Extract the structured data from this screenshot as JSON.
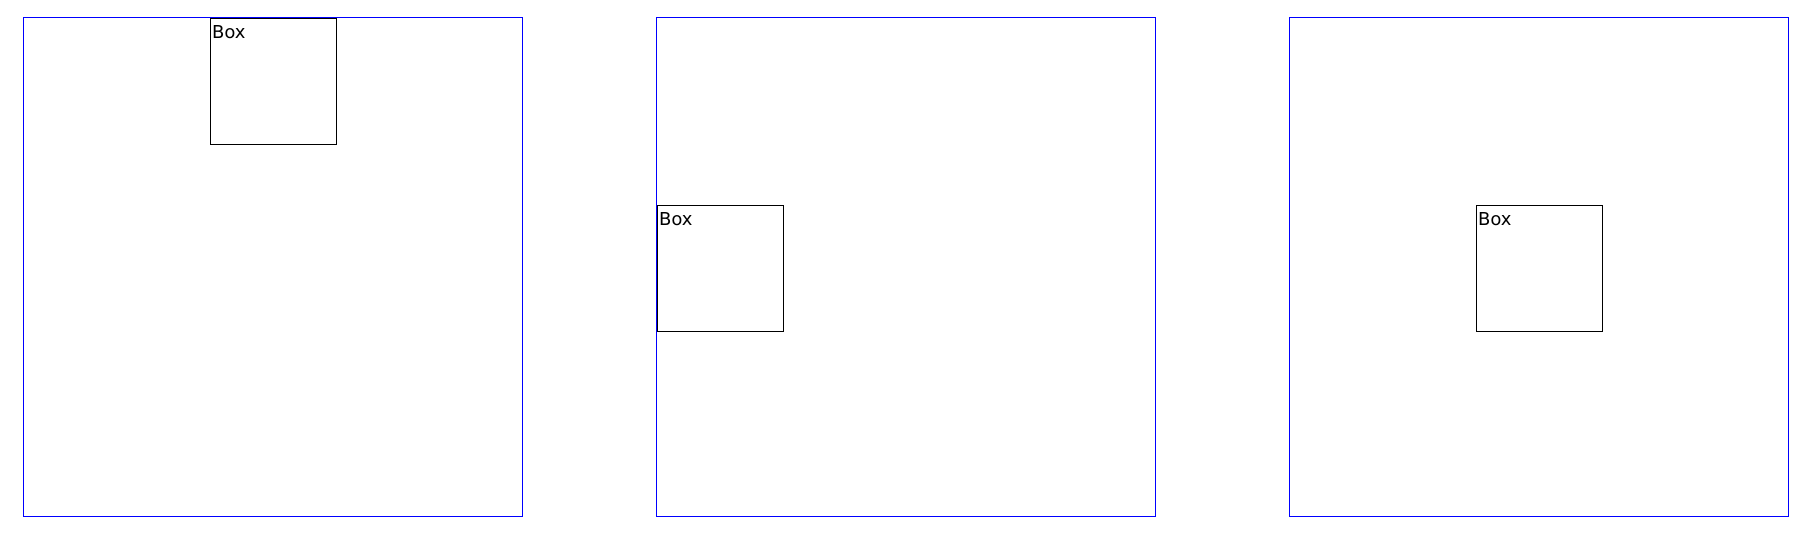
{
  "colors": {
    "container_border": "#0000ff",
    "box_border": "#000000",
    "background": "#ffffff"
  },
  "panels": [
    {
      "box": {
        "label": "Box",
        "placement": "top-center"
      }
    },
    {
      "box": {
        "label": "Box",
        "placement": "left-middle"
      }
    },
    {
      "box": {
        "label": "Box",
        "placement": "center"
      }
    }
  ]
}
